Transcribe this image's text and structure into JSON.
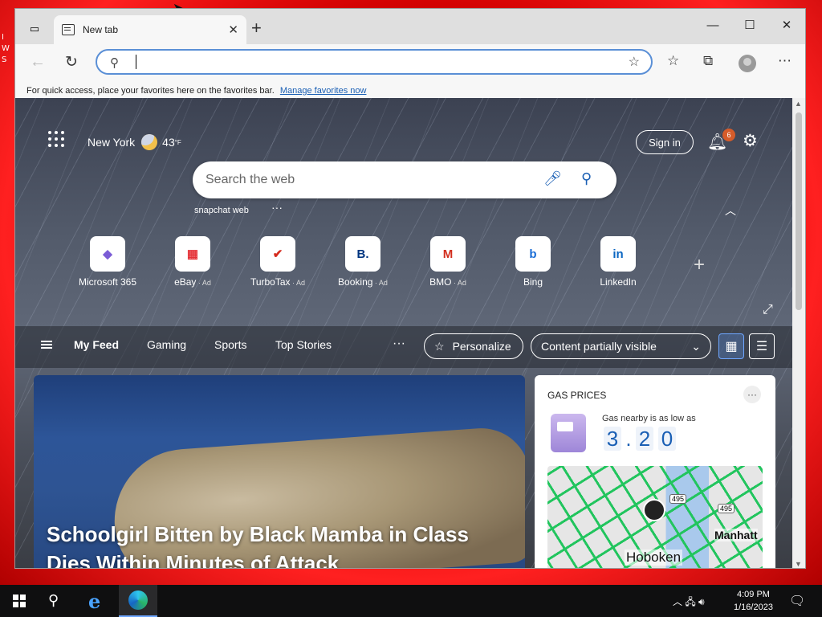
{
  "desktop": {
    "edge_text": "I\nW\nS"
  },
  "browser": {
    "tab_title": "New tab",
    "tab_close": "✕",
    "new_tab": "+",
    "window_controls": {
      "minimize": "—",
      "maximize": "☐",
      "close": "✕"
    },
    "address_value": "",
    "favorites_hint": "For quick access, place your favorites here on the favorites bar.",
    "manage_favorites": "Manage favorites now"
  },
  "newtab": {
    "location": "New York",
    "temperature": "43",
    "temp_unit": "°F",
    "sign_in": "Sign in",
    "notifications_count": "6",
    "search_placeholder": "Search the web",
    "trending": "snapchat web",
    "quick_links": [
      {
        "label": "Microsoft 365",
        "ad": "",
        "glyph": "◆",
        "color": "#7b5cd6"
      },
      {
        "label": "eBay",
        "ad": "· Ad",
        "glyph": "▦",
        "color": "#e53238"
      },
      {
        "label": "TurboTax",
        "ad": "· Ad",
        "glyph": "✔",
        "color": "#d52b1e"
      },
      {
        "label": "Booking",
        "ad": "· Ad",
        "glyph": "B.",
        "color": "#003580"
      },
      {
        "label": "BMO",
        "ad": "· Ad",
        "glyph": "M",
        "color": "#d22e1e"
      },
      {
        "label": "Bing",
        "ad": "",
        "glyph": "b",
        "color": "#1a6dd6"
      },
      {
        "label": "LinkedIn",
        "ad": "",
        "glyph": "in",
        "color": "#0a66c2"
      }
    ]
  },
  "feed": {
    "tabs": [
      "My Feed",
      "Gaming",
      "Sports",
      "Top Stories"
    ],
    "personalize": "Personalize",
    "content_visibility": "Content partially visible",
    "headline": "Schoolgirl Bitten by Black Mamba in Class Dies Within Minutes of Attack",
    "gas": {
      "title": "GAS PRICES",
      "subtitle": "Gas nearby is as low as",
      "digits": [
        "3",
        ".",
        "2",
        "0"
      ],
      "map_city": "Hoboken",
      "map_city2": "Manhatt",
      "highway": "495"
    }
  },
  "taskbar": {
    "time": "4:09 PM",
    "date": "1/16/2023"
  },
  "colors": {
    "accent": "#1a5fb4",
    "desktop": "#d00000",
    "badge": "#d65c2a"
  }
}
